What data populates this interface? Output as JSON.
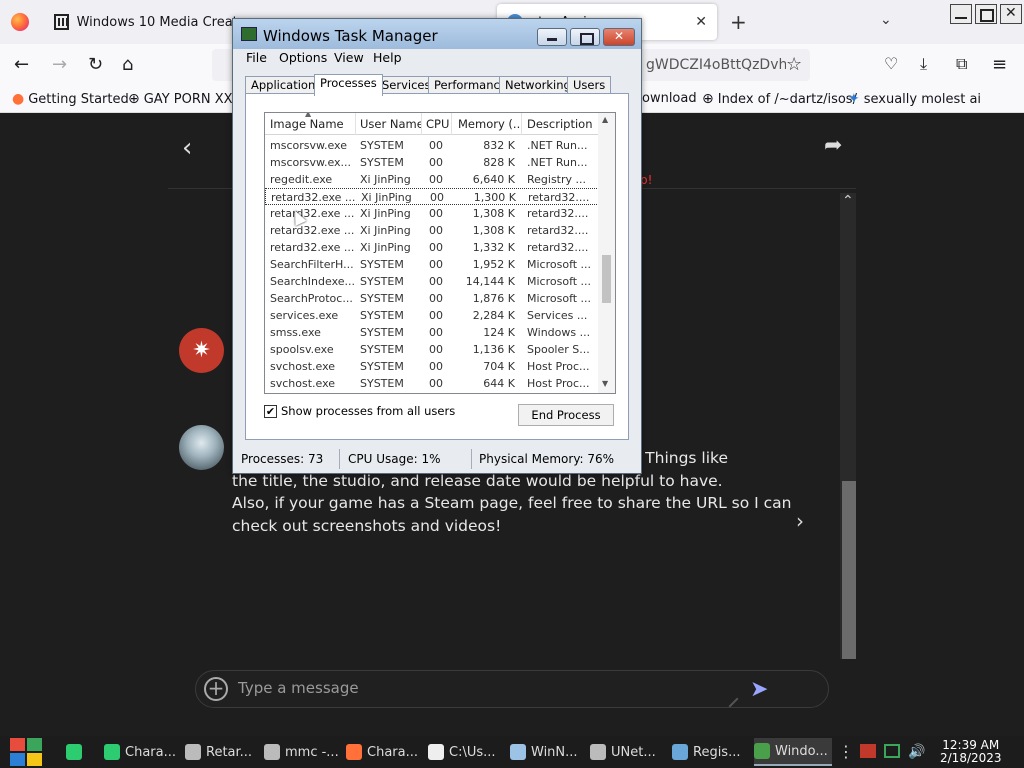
{
  "browser": {
    "tabs": [
      {
        "title": "Windows 10 Media Creation"
      },
      {
        "title": "cter Assi"
      }
    ],
    "url_fragment": "gWDCZI4oBttQzDvh",
    "bookmarks": [
      {
        "label": "Getting Started"
      },
      {
        "label": "GAY PORN XX"
      },
      {
        "label": "ownload"
      },
      {
        "label": "Index of /~dartz/isos/"
      },
      {
        "label": "sexually molest ai"
      }
    ]
  },
  "page": {
    "red_text": "p!",
    "message_lines": [
      "? Things like",
      "the title, the studio, and release date would be helpful to have.",
      "Also, if your game has a Steam page, feel free to share the URL so I can",
      "check out screenshots and videos!"
    ],
    "composer_placeholder": "Type a message"
  },
  "taskmgr": {
    "title": "Windows Task Manager",
    "menu": [
      "File",
      "Options",
      "View",
      "Help"
    ],
    "tabs": [
      "Applications",
      "Processes",
      "Services",
      "Performance",
      "Networking",
      "Users"
    ],
    "active_tab": "Processes",
    "columns": [
      "Image Name",
      "User Name",
      "CPU",
      "Memory (...",
      "Description"
    ],
    "rows": [
      {
        "name": "mscorsvw.exe",
        "user": "SYSTEM",
        "cpu": "00",
        "mem": "832 K",
        "desc": ".NET Run..."
      },
      {
        "name": "mscorsvw.ex...",
        "user": "SYSTEM",
        "cpu": "00",
        "mem": "828 K",
        "desc": ".NET Run..."
      },
      {
        "name": "regedit.exe",
        "user": "Xi JinPing",
        "cpu": "00",
        "mem": "6,640 K",
        "desc": "Registry ..."
      },
      {
        "name": "retard32.exe ...",
        "user": "Xi JinPing",
        "cpu": "00",
        "mem": "1,300 K",
        "desc": "retard32....",
        "selected": true
      },
      {
        "name": "retard32.exe ...",
        "user": "Xi JinPing",
        "cpu": "00",
        "mem": "1,308 K",
        "desc": "retard32...."
      },
      {
        "name": "retard32.exe ...",
        "user": "Xi JinPing",
        "cpu": "00",
        "mem": "1,308 K",
        "desc": "retard32...."
      },
      {
        "name": "retard32.exe ...",
        "user": "Xi JinPing",
        "cpu": "00",
        "mem": "1,332 K",
        "desc": "retard32...."
      },
      {
        "name": "SearchFilterH...",
        "user": "SYSTEM",
        "cpu": "00",
        "mem": "1,952 K",
        "desc": "Microsoft ..."
      },
      {
        "name": "SearchIndexe...",
        "user": "SYSTEM",
        "cpu": "00",
        "mem": "14,144 K",
        "desc": "Microsoft ..."
      },
      {
        "name": "SearchProtoc...",
        "user": "SYSTEM",
        "cpu": "00",
        "mem": "1,876 K",
        "desc": "Microsoft ..."
      },
      {
        "name": "services.exe",
        "user": "SYSTEM",
        "cpu": "00",
        "mem": "2,284 K",
        "desc": "Services ..."
      },
      {
        "name": "smss.exe",
        "user": "SYSTEM",
        "cpu": "00",
        "mem": "124 K",
        "desc": "Windows ..."
      },
      {
        "name": "spoolsv.exe",
        "user": "SYSTEM",
        "cpu": "00",
        "mem": "1,136 K",
        "desc": "Spooler S..."
      },
      {
        "name": "svchost.exe",
        "user": "SYSTEM",
        "cpu": "00",
        "mem": "704 K",
        "desc": "Host Proc..."
      },
      {
        "name": "svchost.exe",
        "user": "SYSTEM",
        "cpu": "00",
        "mem": "644 K",
        "desc": "Host Proc..."
      }
    ],
    "show_all_label": "Show processes from all users",
    "show_all_checked": true,
    "end_process_label": "End Process",
    "status": {
      "processes": "Processes: 73",
      "cpu": "CPU Usage: 1%",
      "memory": "Physical Memory: 76%"
    }
  },
  "taskbar": {
    "items": [
      {
        "label": "Chara...",
        "icon": "chat-icon"
      },
      {
        "label": "Retar...",
        "icon": "pen-icon"
      },
      {
        "label": "mmc -...",
        "icon": "pen-icon"
      },
      {
        "label": "Chara...",
        "icon": "firefox-icon"
      },
      {
        "label": "C:\\Us...",
        "icon": "cmd-icon"
      },
      {
        "label": "WinN...",
        "icon": "doc-icon"
      },
      {
        "label": "UNet...",
        "icon": "pen-icon"
      },
      {
        "label": "Regis...",
        "icon": "registry-icon"
      },
      {
        "label": "Windo...",
        "icon": "taskmgr-icon",
        "active": true
      }
    ],
    "clock_time": "12:39 AM",
    "clock_date": "2/18/2023"
  }
}
